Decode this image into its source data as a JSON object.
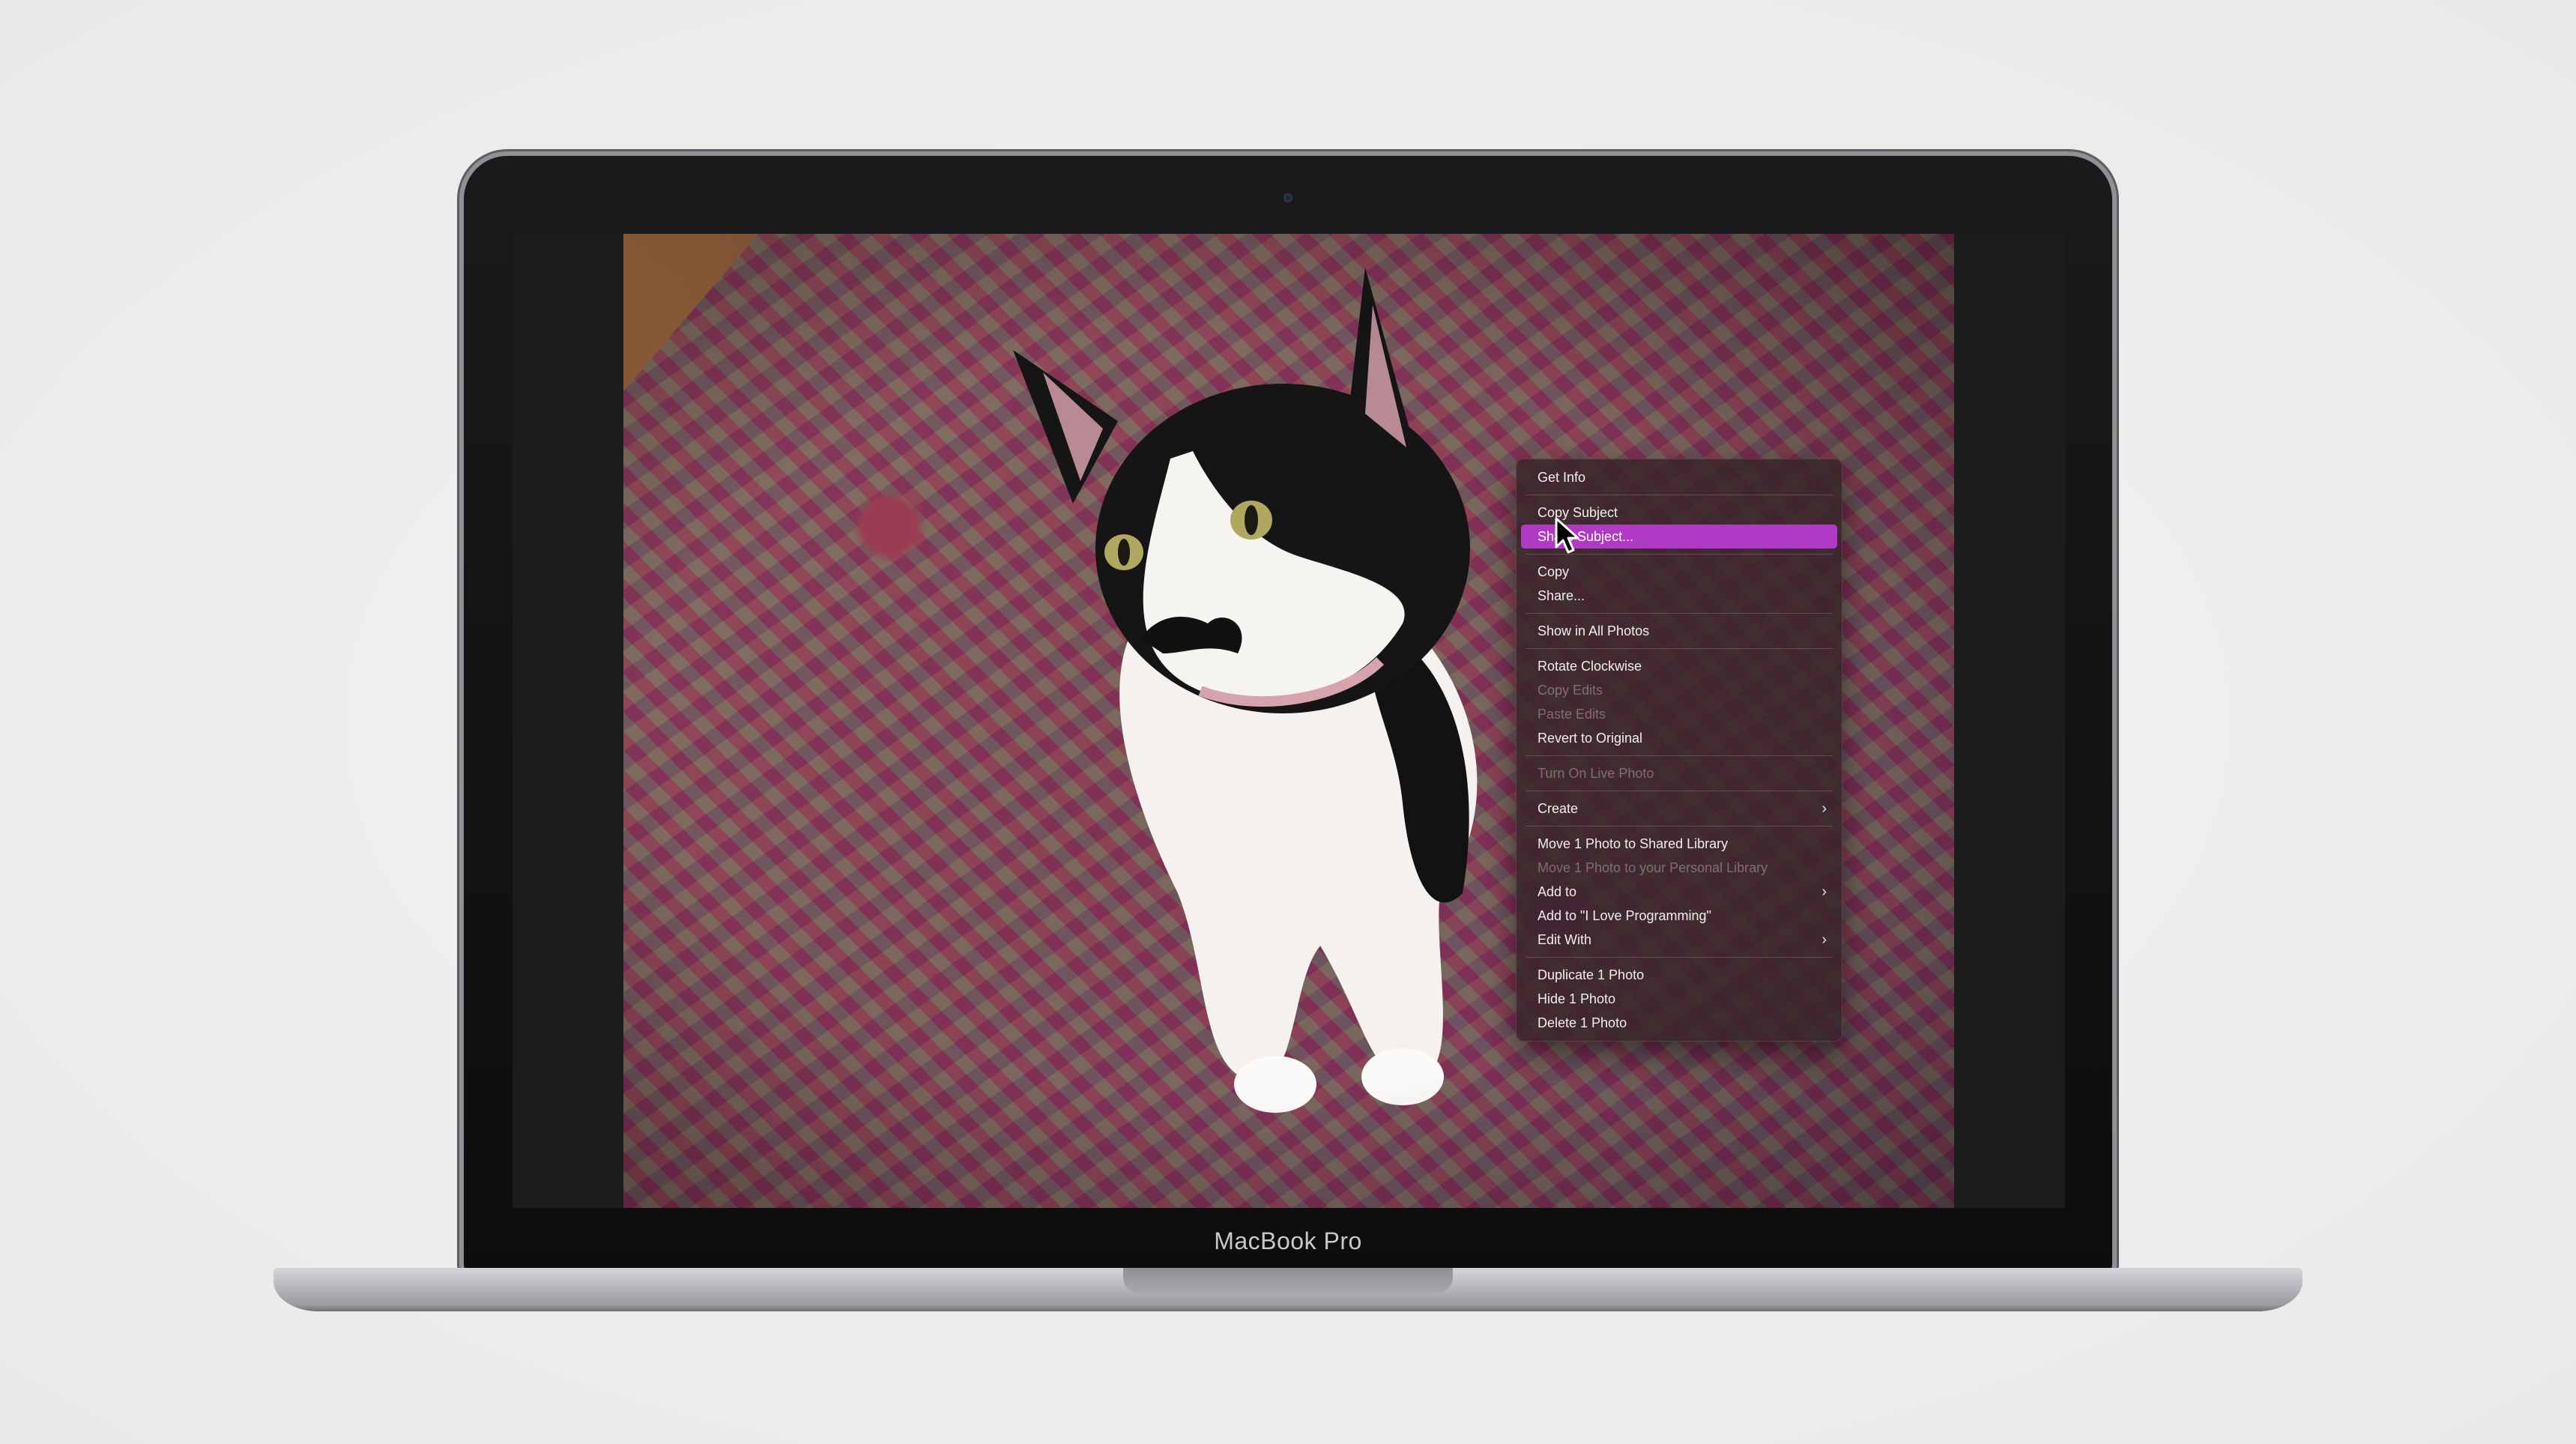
{
  "device": {
    "label": "MacBook Pro"
  },
  "context_menu": {
    "items": [
      {
        "label": "Get Info",
        "enabled": true
      },
      {
        "separator": true
      },
      {
        "label": "Copy Subject",
        "enabled": true
      },
      {
        "label": "Share Subject...",
        "enabled": true,
        "highlighted": true
      },
      {
        "separator": true
      },
      {
        "label": "Copy",
        "enabled": true
      },
      {
        "label": "Share...",
        "enabled": true
      },
      {
        "separator": true
      },
      {
        "label": "Show in All Photos",
        "enabled": true
      },
      {
        "separator": true
      },
      {
        "label": "Rotate Clockwise",
        "enabled": true
      },
      {
        "label": "Copy Edits",
        "enabled": false
      },
      {
        "label": "Paste Edits",
        "enabled": false
      },
      {
        "label": "Revert to Original",
        "enabled": true
      },
      {
        "separator": true
      },
      {
        "label": "Turn On Live Photo",
        "enabled": false
      },
      {
        "separator": true
      },
      {
        "label": "Create",
        "enabled": true,
        "submenu": true
      },
      {
        "separator": true
      },
      {
        "label": "Move 1 Photo to Shared Library",
        "enabled": true
      },
      {
        "label": "Move 1 Photo to your Personal Library",
        "enabled": false
      },
      {
        "label": "Add to",
        "enabled": true,
        "submenu": true
      },
      {
        "label": "Add to \"I Love Programming\"",
        "enabled": true
      },
      {
        "label": "Edit With",
        "enabled": true,
        "submenu": true
      },
      {
        "separator": true
      },
      {
        "label": "Duplicate 1 Photo",
        "enabled": true
      },
      {
        "label": "Hide 1 Photo",
        "enabled": true
      },
      {
        "label": "Delete 1 Photo",
        "enabled": true
      }
    ],
    "submenu_glyph": "›",
    "highlight_color": "#b13ac4"
  },
  "photo": {
    "icon": "cat-photo"
  },
  "cursor": {
    "icon": "pointer-arrow-icon"
  }
}
